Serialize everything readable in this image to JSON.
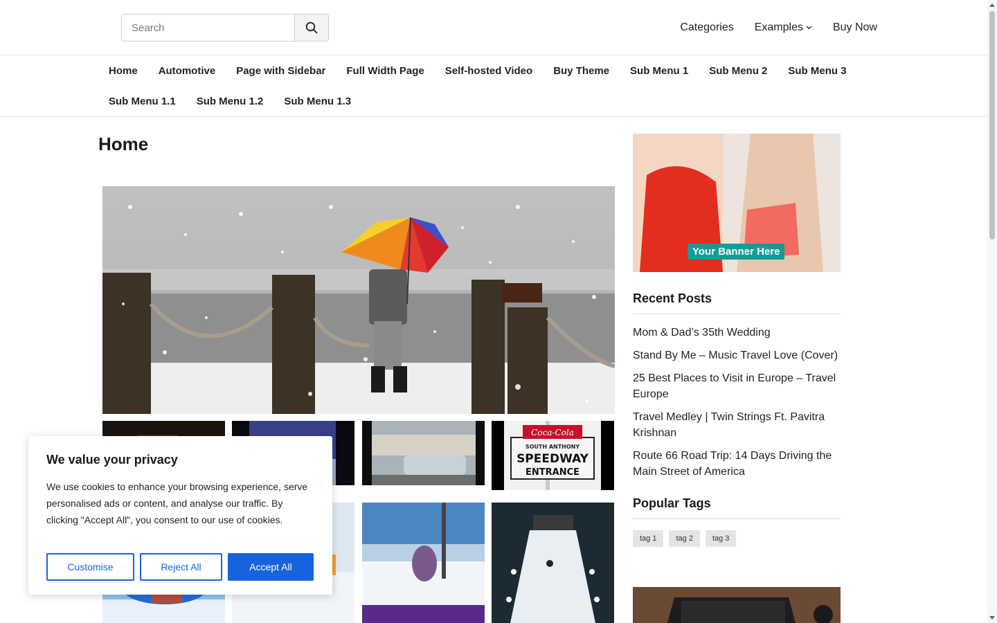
{
  "header": {
    "search_placeholder": "Search",
    "links": [
      {
        "label": "Categories"
      },
      {
        "label": "Examples",
        "has_dropdown": true
      },
      {
        "label": "Buy Now"
      }
    ]
  },
  "nav": {
    "row1": [
      "Home",
      "Automotive",
      "Page with Sidebar",
      "Full Width Page",
      "Self-hosted Video",
      "Buy Theme",
      "Sub Menu 1",
      "Sub Menu 2",
      "Sub Menu 3"
    ],
    "row2": [
      "Sub Menu 1.1",
      "Sub Menu 1.2",
      "Sub Menu 1.3"
    ]
  },
  "page": {
    "title": "Home"
  },
  "sidebar": {
    "banner_label": "Your Banner Here",
    "recent_posts_title": "Recent Posts",
    "recent_posts": [
      "Mom & Dad’s 35th Wedding",
      "Stand By Me – Music Travel Love (Cover)",
      "25 Best Places to Visit in Europe – Travel Europe",
      "Travel Medley | Twin Strings Ft. Pavitra Krishnan",
      "Route 66 Road Trip: 14 Days Driving the Main Street of America"
    ],
    "popular_tags_title": "Popular Tags",
    "tags": [
      "tag 1",
      "tag 2",
      "tag 3"
    ]
  },
  "cookie": {
    "title": "We value your privacy",
    "text": "We use cookies to enhance your browsing experience, serve personalised ads or content, and analyse our traffic. By clicking \"Accept All\", you consent to our use of cookies.",
    "customise": "Customise",
    "reject": "Reject All",
    "accept": "Accept All"
  },
  "speedway_sign": {
    "brand": "Coca-Cola",
    "line1": "SOUTH ANTHONY",
    "line2": "SPEEDWAY",
    "line3": "ENTRANCE"
  },
  "colors": {
    "accent": "#1863dc",
    "banner_label_bg": "#0f9e96"
  }
}
